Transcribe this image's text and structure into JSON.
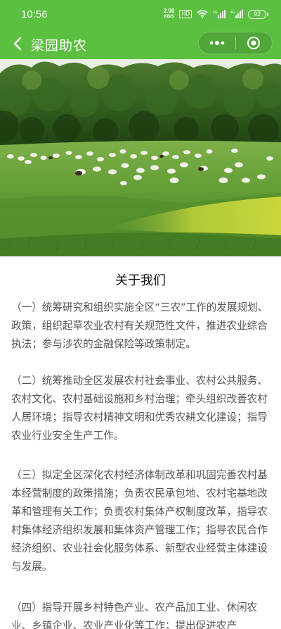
{
  "status_bar": {
    "time": "10:56",
    "net_speed_value": "2.00",
    "net_speed_unit": "KB/S",
    "hd_badge": "HD",
    "battery": "92"
  },
  "navbar": {
    "title": "梁园助农",
    "accent_color": "#5bbf3f"
  },
  "hero": {
    "icon": "sheep-pasture-photo"
  },
  "article": {
    "title": "关于我们",
    "paragraphs": [
      "（一）统筹研究和组织实施全区“三农”工作的发展规划、政策，组织起草农业农村有关规范性文件，推进农业综合执法；参与涉农的金融保险等政策制定。",
      "（二）统筹推动全区发展农村社会事业、农村公共服务、农村文化、农村基础设施和乡村治理；牵头组织改善农村人居环境；指导农村精神文明和优秀农耕文化建设；指导农业行业安全生产工作。",
      "（三）拟定全区深化农村经济体制改革和巩固完善农村基本经营制度的政策措施；负责农民承包地、农村宅基地改革和管理有关工作；负责农村集体产权制度改革，指导农村集体经济组织发展和集体资产管理工作；指导农民合作经济组织、农业社会化服务体系、新型农业经营主体建设与发展。",
      "（四）指导开展乡村特色产业、农产品加工业、休闲农业、乡镇企业、农业产业化等工作；提出促进农产"
    ]
  }
}
